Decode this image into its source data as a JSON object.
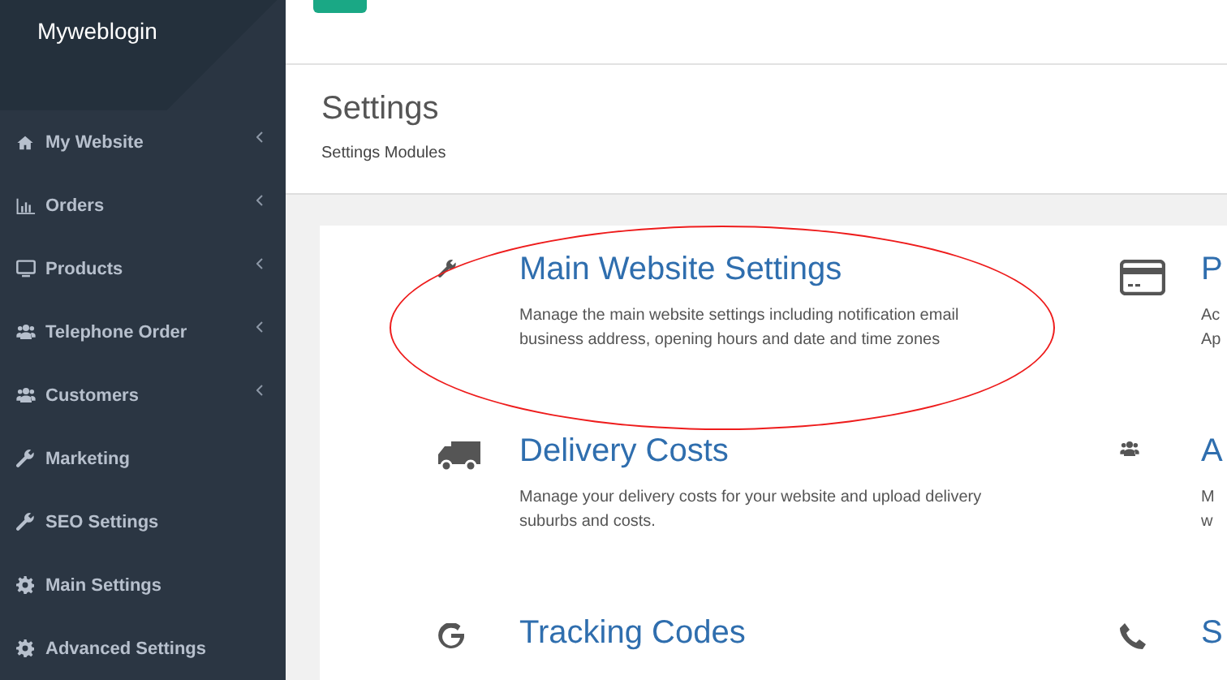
{
  "brand": "Myweblogin",
  "sidebar": {
    "items": [
      {
        "label": "My Website",
        "kind": "home",
        "submenu": true
      },
      {
        "label": "Orders",
        "kind": "chart",
        "submenu": true
      },
      {
        "label": "Products",
        "kind": "monitor",
        "submenu": true
      },
      {
        "label": "Telephone Order",
        "kind": "users",
        "submenu": true
      },
      {
        "label": "Customers",
        "kind": "users",
        "submenu": true
      },
      {
        "label": "Marketing",
        "kind": "wrench",
        "submenu": false
      },
      {
        "label": "SEO Settings",
        "kind": "wrench",
        "submenu": false
      },
      {
        "label": "Main Settings",
        "kind": "gear",
        "submenu": false
      },
      {
        "label": "Advanced Settings",
        "kind": "gear",
        "submenu": false
      }
    ]
  },
  "header": {
    "title": "Settings",
    "subtitle": "Settings Modules"
  },
  "modules": [
    {
      "kind": "wrench",
      "title": "Main Website Settings",
      "lines": [
        "Manage the main website settings including notification email business address, opening hours and date and time zones"
      ],
      "highlighted": true
    },
    {
      "kind": "card",
      "title": "P",
      "lines": [
        "Ac",
        "Ap"
      ],
      "highlighted": false
    },
    {
      "kind": "truck",
      "title": "Delivery Costs",
      "lines": [
        "Manage your delivery costs for your website and upload delivery suburbs and costs."
      ],
      "highlighted": false
    },
    {
      "kind": "users",
      "title": "A",
      "lines": [
        "M",
        "w"
      ],
      "highlighted": false
    },
    {
      "kind": "google",
      "title": "Tracking Codes",
      "highlighted": false
    },
    {
      "kind": "phone",
      "title": "S",
      "highlighted": false
    }
  ]
}
